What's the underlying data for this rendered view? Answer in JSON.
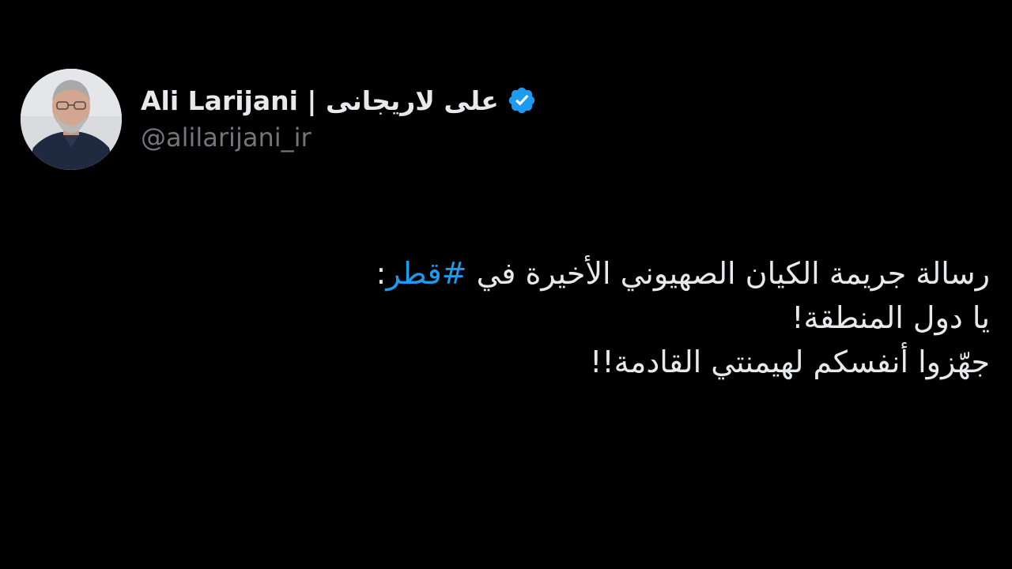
{
  "author": {
    "display_name": "Ali Larijani | على لاريجانى",
    "handle": "@alilarijani_ir",
    "verified": true,
    "verified_icon": "verified-badge-icon",
    "verified_color": "#1d9bf0"
  },
  "tweet": {
    "line1_before": "رسالة جريمة الكيان الصهيوني الأخيرة في ",
    "hashtag": "#قطر",
    "line1_after": ":",
    "line2": "يا دول المنطقة!",
    "line3": "جهّزوا أنفسكم لهيمنتي القادمة!!"
  },
  "colors": {
    "background": "#000000",
    "text": "#e7e9ea",
    "secondary_text": "#71767b",
    "link": "#1d9bf0"
  }
}
